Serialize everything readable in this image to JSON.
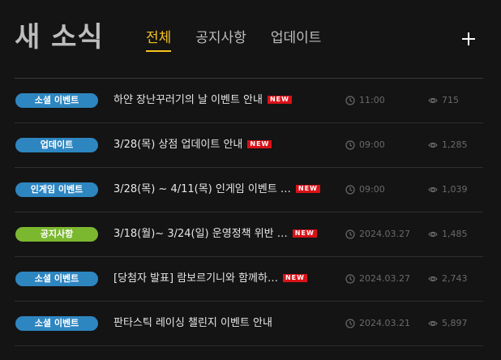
{
  "header": {
    "title": "새 소식",
    "tabs": [
      {
        "label": "전체",
        "active": true
      },
      {
        "label": "공지사항",
        "active": false
      },
      {
        "label": "업데이트",
        "active": false
      }
    ],
    "add_icon": "plus-icon"
  },
  "colors": {
    "accent": "#f7c31e",
    "badge_blue": "#2e86c1",
    "badge_green": "#7cb82f",
    "new_red": "#d91218"
  },
  "icons": {
    "time": "clock-icon",
    "views": "eye-icon"
  },
  "posts": [
    {
      "category": "소셜 이벤트",
      "category_color": "#2e86c1",
      "title": "하얀 장난꾸러기의 날 이벤트 안내",
      "is_new": true,
      "new_label": "NEW",
      "time": "11:00",
      "views": "715"
    },
    {
      "category": "업데이트",
      "category_color": "#2e86c1",
      "title": "3/28(목) 상점 업데이트 안내",
      "is_new": true,
      "new_label": "NEW",
      "time": "09:00",
      "views": "1,285"
    },
    {
      "category": "인게임 이벤트",
      "category_color": "#2e86c1",
      "title": "3/28(목) ~ 4/11(목) 인게임 이벤트 …",
      "is_new": true,
      "new_label": "NEW",
      "time": "09:00",
      "views": "1,039"
    },
    {
      "category": "공지사항",
      "category_color": "#7cb82f",
      "title": "3/18(월)~ 3/24(일) 운영정책 위반 …",
      "is_new": true,
      "new_label": "NEW",
      "time": "2024.03.27",
      "views": "1,485"
    },
    {
      "category": "소셜 이벤트",
      "category_color": "#2e86c1",
      "title": "[당첨자 발표] 람보르기니와 함께하…",
      "is_new": true,
      "new_label": "NEW",
      "time": "2024.03.27",
      "views": "2,743"
    },
    {
      "category": "소셜 이벤트",
      "category_color": "#2e86c1",
      "title": "판타스틱 레이싱 챌린지 이벤트 안내",
      "is_new": false,
      "new_label": "",
      "time": "2024.03.21",
      "views": "5,897"
    }
  ]
}
